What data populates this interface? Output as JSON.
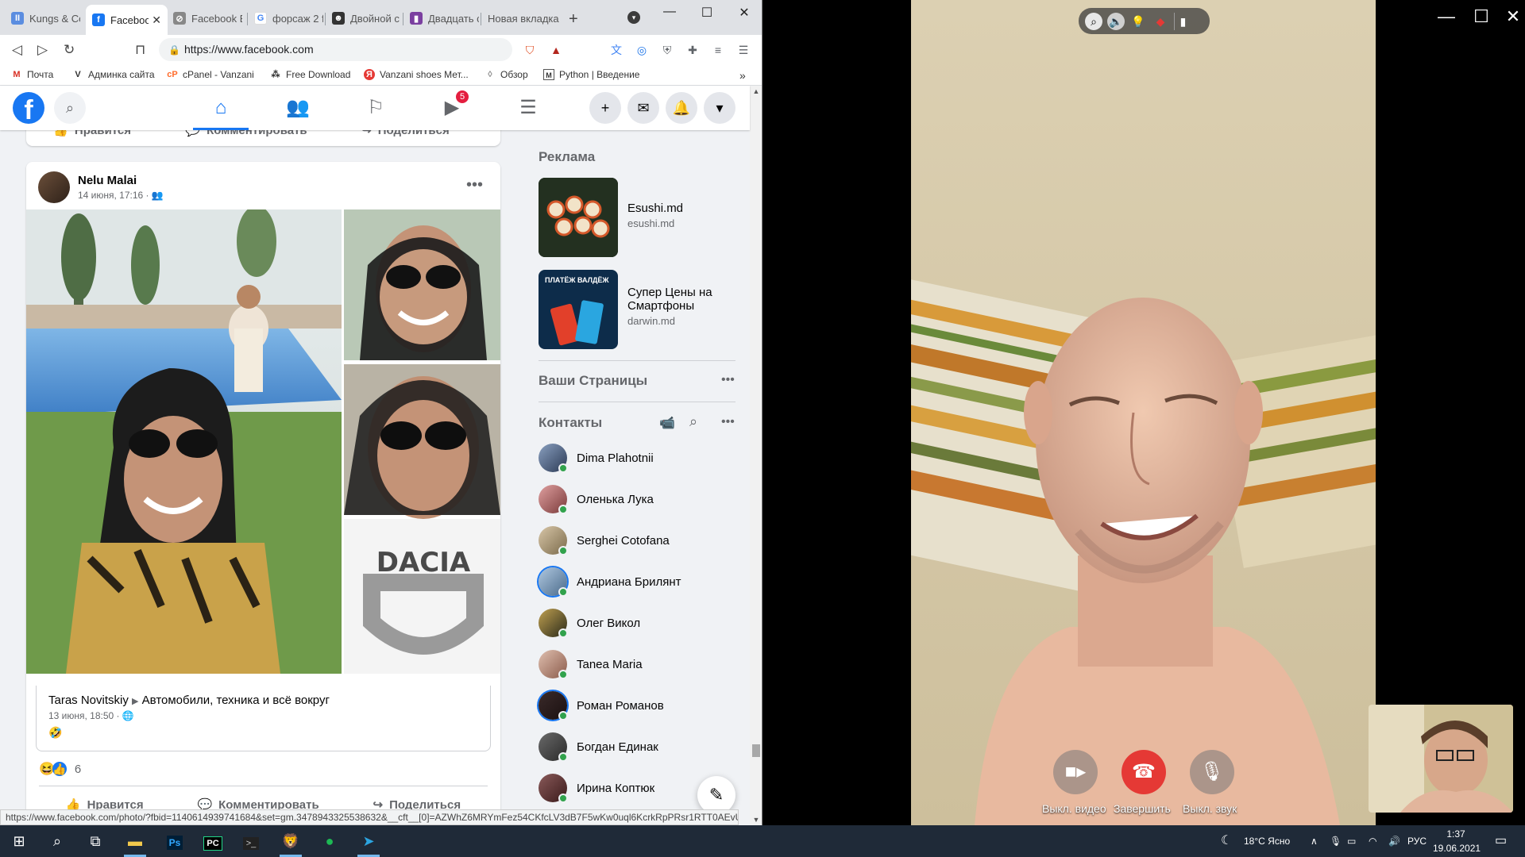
{
  "browser": {
    "tabs": [
      {
        "title": "Kungs & Co",
        "color": "#5b8de0"
      },
      {
        "title": "Facebook",
        "color": "#1877f2",
        "active": true
      },
      {
        "title": "Facebook B",
        "color": "#777"
      },
      {
        "title": "форсаж 2 f",
        "color": "#4285f4"
      },
      {
        "title": "Двойной с",
        "color": "#333"
      },
      {
        "title": "Двадцать с",
        "color": "#7b3fa0"
      },
      {
        "title": "Новая вкладка",
        "color": ""
      }
    ],
    "url": "https://www.facebook.com",
    "bookmarks": [
      "Почта",
      "Админка сайта",
      "cPanel - Vanzani",
      "Free Download",
      "Vanzani shoes Мет...",
      "Обзор",
      "Python | Введение"
    ],
    "bookmarks_more": "»",
    "status_url": "https://www.facebook.com/photo/?fbid=1140614939741684&set=gm.3478943325538632&__cft__[0]=AZWhZ6MRYmFez54CKfcLV3dB7F5wKw0uql6KcrkRpPRsr1RTT0AEvU..."
  },
  "fb": {
    "nav_badge": "5",
    "prev_post_actions": {
      "like": "Нравится",
      "comment": "Комментировать",
      "share": "Поделиться"
    },
    "post": {
      "author": "Nelu Malai",
      "time": "14 июня, 17:16 · ",
      "photo_brand": "DACIA",
      "shared_author": "Taras Novitskiy",
      "shared_group": "Автомобили, техника и всё вокруг",
      "shared_time": "13 июня, 18:50 · ",
      "reactions_count": "6",
      "actions": {
        "like": "Нравится",
        "comment": "Комментировать",
        "share": "Поделиться"
      }
    },
    "sidebar": {
      "ads_title": "Реклама",
      "ads": [
        {
          "title": "Esushi.md",
          "domain": "esushi.md"
        },
        {
          "title": "Супер Цены на Смартфоны",
          "domain": "darwin.md",
          "thumb_text": "ПЛАТЁЖ ВАЛДЁЖ"
        }
      ],
      "pages_title": "Ваши Страницы",
      "contacts_title": "Контакты",
      "contacts": [
        "Dima Plahotnii",
        "Оленька Лука",
        "Serghei Cotofana",
        "Андриана Брилянт",
        "Олег Викол",
        "Tanea Maria",
        "Роман Романов",
        "Богдан Единак",
        "Ирина Коптюк"
      ]
    }
  },
  "call": {
    "video_label": "Выкл. видео",
    "end_label": "Завершить",
    "mute_label": "Выкл. звук",
    "end_color": "#e53935"
  },
  "taskbar": {
    "weather": "18°C  Ясно",
    "lang": "РУС",
    "time": "1:37",
    "date": "19.06.2021"
  }
}
